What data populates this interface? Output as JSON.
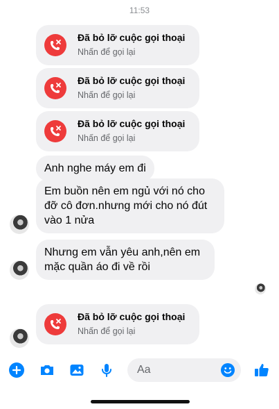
{
  "status": {
    "time": "11:53"
  },
  "missed_call": {
    "title": "Đã bỏ lỡ cuộc gọi thoại",
    "subtitle": "Nhấn để gọi lại"
  },
  "messages": [
    {
      "text": "Anh nghe máy em đi"
    },
    {
      "line1": "Em buồn nên em ngủ với nó cho",
      "line2": "đỡ cô đơn.nhưng mới cho nó đút",
      "line3": "vào 1 nửa"
    },
    {
      "line1": "Nhưng em vẫn yêu anh,nên em",
      "line2": "mặc quần áo đi về rồi"
    }
  ],
  "composer": {
    "placeholder": "Aa"
  },
  "colors": {
    "accent": "#0084ff",
    "missed_call_icon": "#ee3b3b",
    "bubble": "#f0f0f2"
  },
  "icons": [
    "plus-icon",
    "camera-icon",
    "image-icon",
    "mic-icon",
    "emoji-icon",
    "like-icon",
    "phone-missed-icon"
  ]
}
